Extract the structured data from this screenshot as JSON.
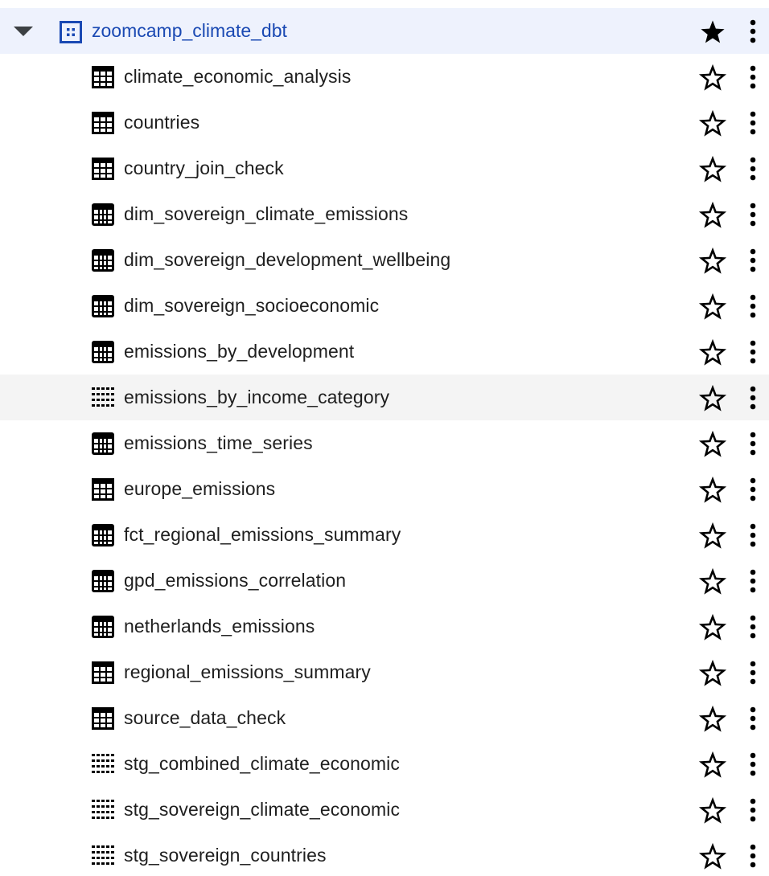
{
  "dataset": {
    "name": "zoomcamp_climate_dbt",
    "starred": true,
    "expanded": true,
    "icon": "dataset-icon"
  },
  "items": [
    {
      "name": "climate_economic_analysis",
      "icon": "table-icon"
    },
    {
      "name": "countries",
      "icon": "table-icon"
    },
    {
      "name": "country_join_check",
      "icon": "table-icon"
    },
    {
      "name": "dim_sovereign_climate_emissions",
      "icon": "view-icon"
    },
    {
      "name": "dim_sovereign_development_wellbeing",
      "icon": "view-icon"
    },
    {
      "name": "dim_sovereign_socioeconomic",
      "icon": "view-icon"
    },
    {
      "name": "emissions_by_development",
      "icon": "view-icon"
    },
    {
      "name": "emissions_by_income_category",
      "icon": "dotted-view-icon"
    },
    {
      "name": "emissions_time_series",
      "icon": "view-icon"
    },
    {
      "name": "europe_emissions",
      "icon": "table-icon"
    },
    {
      "name": "fct_regional_emissions_summary",
      "icon": "view-icon"
    },
    {
      "name": "gpd_emissions_correlation",
      "icon": "view-icon"
    },
    {
      "name": "netherlands_emissions",
      "icon": "view-icon"
    },
    {
      "name": "regional_emissions_summary",
      "icon": "table-icon"
    },
    {
      "name": "source_data_check",
      "icon": "table-icon"
    },
    {
      "name": "stg_combined_climate_economic",
      "icon": "dotted-view-icon"
    },
    {
      "name": "stg_sovereign_climate_economic",
      "icon": "dotted-view-icon"
    },
    {
      "name": "stg_sovereign_countries",
      "icon": "dotted-view-icon"
    }
  ],
  "hovered_index": 7,
  "colors": {
    "dataset_bg": "#eef2fd",
    "dataset_text": "#1a49b3",
    "hover_bg": "#f4f4f4",
    "text": "#1f1f1f"
  }
}
